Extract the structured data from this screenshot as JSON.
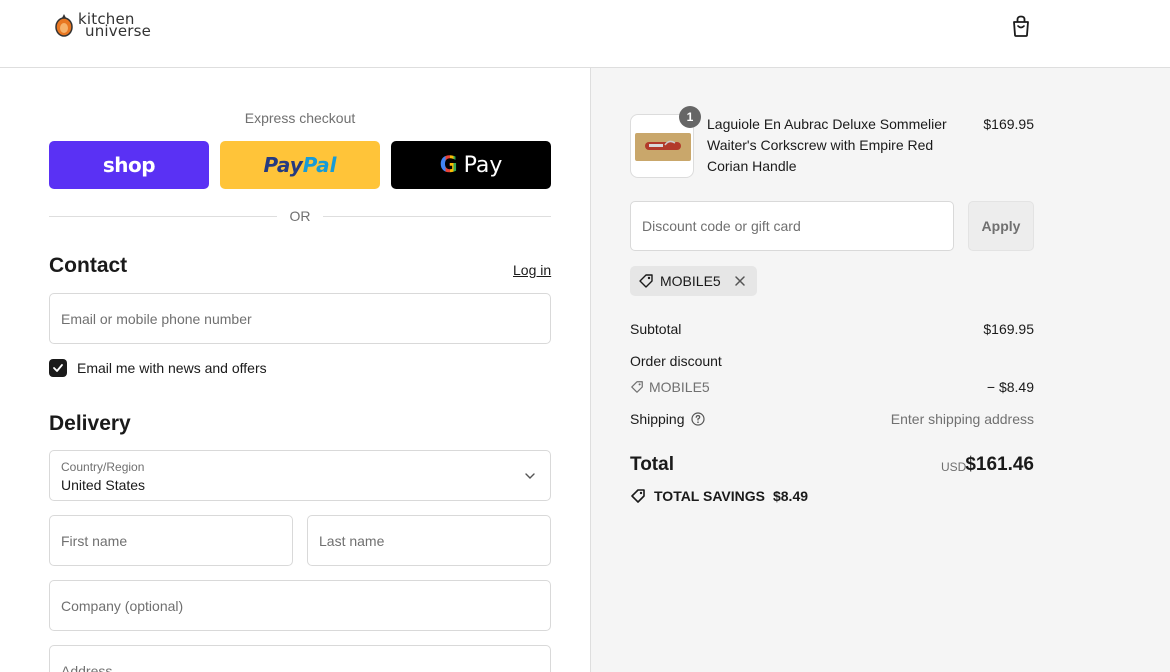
{
  "header": {
    "logo_line1": "kitchen",
    "logo_line2": "universe"
  },
  "express": {
    "label": "Express checkout",
    "shop_label": "shop",
    "paypal_part1": "Pay",
    "paypal_part2": "Pal",
    "gpay_g": "G",
    "gpay_label": "Pay",
    "or_text": "OR"
  },
  "contact": {
    "title": "Contact",
    "login_label": "Log in",
    "email_placeholder": "Email me with news and offers",
    "email_field_placeholder": "Email or mobile phone number",
    "newsletter_checked": true
  },
  "delivery": {
    "title": "Delivery",
    "country_label": "Country/Region",
    "country_value": "United States",
    "first_name_placeholder": "First name",
    "last_name_placeholder": "Last name",
    "company_placeholder": "Company (optional)",
    "address_placeholder": "Address"
  },
  "order": {
    "item": {
      "quantity": "1",
      "name": "Laguiole En Aubrac Deluxe Sommelier Waiter's Corkscrew with Empire Red Corian Handle",
      "price": "$169.95"
    },
    "discount_placeholder": "Discount code or gift card",
    "apply_label": "Apply",
    "applied_code": "MOBILE5",
    "subtotal_label": "Subtotal",
    "subtotal_value": "$169.95",
    "order_discount_label": "Order discount",
    "discount_code": "MOBILE5",
    "discount_value": "− $8.49",
    "shipping_label": "Shipping",
    "shipping_value": "Enter shipping address",
    "total_label": "Total",
    "total_currency": "USD",
    "total_value": "$161.46",
    "savings_label": "TOTAL SAVINGS",
    "savings_value": "$8.49"
  },
  "colors": {
    "shop_purple": "#5a31f4",
    "paypal_yellow": "#ffc439",
    "gpay_black": "#000000",
    "summary_bg": "#f5f5f5"
  }
}
